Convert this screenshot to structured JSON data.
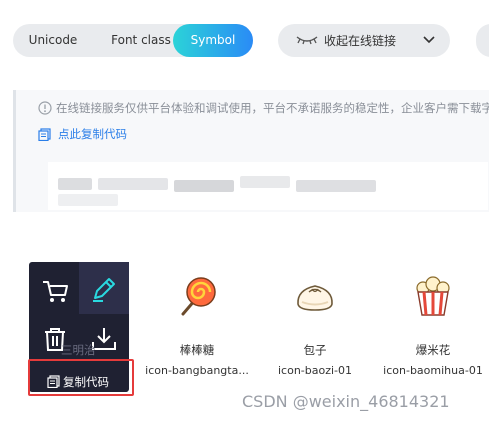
{
  "tabs": {
    "unicode": "Unicode",
    "font_class": "Font class",
    "symbol": "Symbol"
  },
  "link_toggle": {
    "label": "收起在线链接"
  },
  "notice": {
    "text": "在线链接服务仅供平台体验和调试使用，平台不承诺服务的稳定性，企业客户需下载字",
    "copy_link": "点此复制代码"
  },
  "icons": [
    {
      "name": "棒棒糖",
      "code": "icon-bangbangta..."
    },
    {
      "name": "包子",
      "code": "icon-baozi-01"
    },
    {
      "name": "爆米花",
      "code": "icon-baomihua-01"
    }
  ],
  "hover_card": {
    "ghost_name": "三明治",
    "copy_label": "复制代码"
  },
  "watermark": "CSDN @weixin_46814321",
  "colors": {
    "accent_gradient_start": "#2bd3d8",
    "accent_gradient_end": "#2a8bf6",
    "link": "#2a7ee8",
    "highlight_frame": "#e53b3b",
    "overlay_bg": "#1f2132",
    "overlay_icon": "#2ad9e0"
  }
}
